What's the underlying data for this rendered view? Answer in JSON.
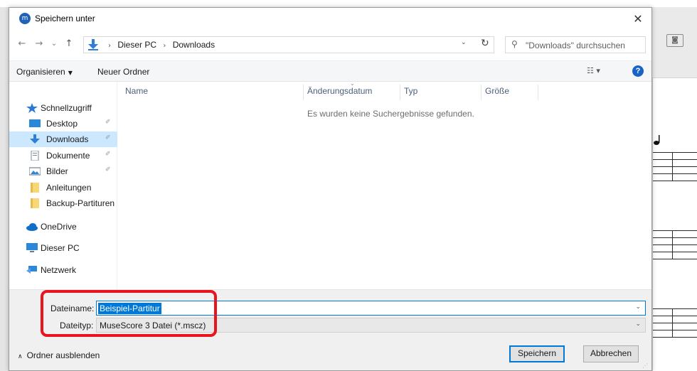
{
  "dialog": {
    "title": "Speichern unter",
    "app_icon": "musescore-icon",
    "close_glyph": "✕"
  },
  "nav": {
    "back_glyph": "←",
    "forward_glyph": "→",
    "recent_glyph": "⌄",
    "up_glyph": "↑",
    "path": [
      "Dieser PC",
      "Downloads"
    ],
    "path_separator": "›",
    "dropdown_glyph": "⌄",
    "refresh_glyph": "↻",
    "search_placeholder": "\"Downloads\" durchsuchen",
    "search_glyph": "⚲"
  },
  "commands": {
    "organize_label": "Organisieren",
    "new_folder_label": "Neuer Ordner",
    "view_glyph": "☷ ▾",
    "help_glyph": "?"
  },
  "sidebar": {
    "items": [
      {
        "label": "Schnellzugriff",
        "icon": "star-icon",
        "pinned": false,
        "active": false
      },
      {
        "label": "Desktop",
        "icon": "desktop-icon",
        "pinned": true,
        "active": false
      },
      {
        "label": "Downloads",
        "icon": "download-icon",
        "pinned": true,
        "active": true
      },
      {
        "label": "Dokumente",
        "icon": "documents-icon",
        "pinned": true,
        "active": false
      },
      {
        "label": "Bilder",
        "icon": "pictures-icon",
        "pinned": true,
        "active": false
      },
      {
        "label": "Anleitungen",
        "icon": "folder-icon",
        "pinned": false,
        "active": false
      },
      {
        "label": "Backup-Partituren",
        "icon": "folder-icon",
        "pinned": false,
        "active": false
      },
      {
        "label": "OneDrive",
        "icon": "cloud-icon",
        "pinned": false,
        "active": false
      },
      {
        "label": "Dieser PC",
        "icon": "computer-icon",
        "pinned": false,
        "active": false
      },
      {
        "label": "Netzwerk",
        "icon": "network-icon",
        "pinned": false,
        "active": false
      }
    ],
    "pin_glyph": "✐"
  },
  "filelist": {
    "columns": [
      "Name",
      "Änderungsdatum",
      "Typ",
      "Größe"
    ],
    "sort_glyph": "⌄",
    "empty_message": "Es wurden keine Suchergebnisse gefunden."
  },
  "save_form": {
    "filename_label": "Dateiname:",
    "filename_value": "Beispiel-Partitur",
    "filetype_label": "Dateityp:",
    "filetype_value": "MuseScore 3 Datei (*.mscz)",
    "dropdown_glyph": "⌄"
  },
  "footer": {
    "hide_folders_label": "Ordner ausblenden",
    "hide_caret_glyph": "∧",
    "save_label": "Speichern",
    "cancel_label": "Abbrechen",
    "grip_glyph": "⋰"
  },
  "background": {
    "camera_glyph": "◙"
  },
  "colors": {
    "accent": "#0078d7",
    "selection": "#cce8ff",
    "highlight_box": "#e8141e"
  }
}
